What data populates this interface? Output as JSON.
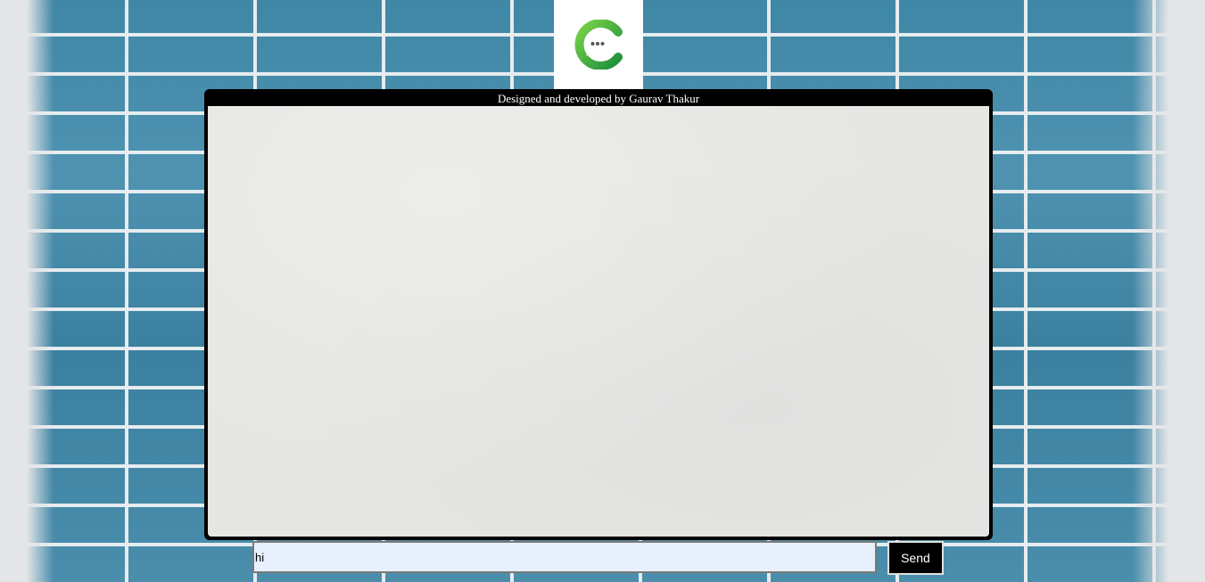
{
  "header": {
    "credit": "Designed and developed by Gaurav Thakur"
  },
  "logo": {
    "icon": "chat-bubble-logo-icon",
    "colors": {
      "ring": "#3cb54a",
      "ring_dark": "#1e8f3a",
      "bubble": "#ffffff"
    }
  },
  "composer": {
    "input_value": "hi",
    "send_label": "Send"
  },
  "colors": {
    "panel_border": "#000000",
    "input_background": "#e8f0fe",
    "button_background": "#000000",
    "button_text": "#ffffff"
  }
}
